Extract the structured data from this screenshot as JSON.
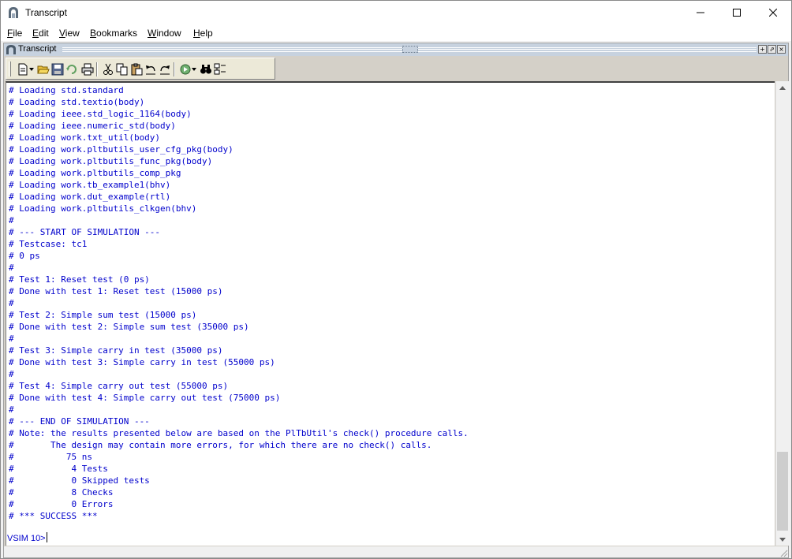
{
  "window": {
    "title": "Transcript",
    "controls": {
      "minimize": "—",
      "maximize": "☐",
      "close": "✕"
    }
  },
  "menu": {
    "file": {
      "accel": "F",
      "rest": "ile"
    },
    "edit": {
      "accel": "E",
      "rest": "dit"
    },
    "view": {
      "accel": "V",
      "rest": "iew"
    },
    "bookmarks": {
      "accel": "B",
      "rest": "ookmarks"
    },
    "window": {
      "accel": "W",
      "rest": "indow"
    },
    "help": {
      "accel": "H",
      "rest": "elp"
    }
  },
  "child": {
    "title": "Transcript"
  },
  "toolbar": {
    "buttons": [
      "new-icon",
      "open-icon",
      "save-icon",
      "reload-icon",
      "print-icon",
      "cut-icon",
      "copy-icon",
      "paste-icon",
      "undo-icon",
      "redo-icon",
      "go-icon",
      "find-icon",
      "options-icon"
    ]
  },
  "transcript": {
    "lines": [
      "# Loading std.standard",
      "# Loading std.textio(body)",
      "# Loading ieee.std_logic_1164(body)",
      "# Loading ieee.numeric_std(body)",
      "# Loading work.txt_util(body)",
      "# Loading work.pltbutils_user_cfg_pkg(body)",
      "# Loading work.pltbutils_func_pkg(body)",
      "# Loading work.pltbutils_comp_pkg",
      "# Loading work.tb_example1(bhv)",
      "# Loading work.dut_example(rtl)",
      "# Loading work.pltbutils_clkgen(bhv)",
      "#",
      "# --- START OF SIMULATION ---",
      "# Testcase: tc1",
      "# 0 ps",
      "#",
      "# Test 1: Reset test (0 ps)",
      "# Done with test 1: Reset test (15000 ps)",
      "#",
      "# Test 2: Simple sum test (15000 ps)",
      "# Done with test 2: Simple sum test (35000 ps)",
      "#",
      "# Test 3: Simple carry in test (35000 ps)",
      "# Done with test 3: Simple carry in test (55000 ps)",
      "#",
      "# Test 4: Simple carry out test (55000 ps)",
      "# Done with test 4: Simple carry out test (75000 ps)",
      "#",
      "# --- END OF SIMULATION ---",
      "# Note: the results presented below are based on the PlTbUtil's check() procedure calls.",
      "#       The design may contain more errors, for which there are no check() calls.",
      "#          75 ns",
      "#           4 Tests",
      "#           0 Skipped tests",
      "#           8 Checks",
      "#           0 Errors",
      "# *** SUCCESS ***"
    ],
    "prompt": "VSIM 10>"
  },
  "colors": {
    "transcript_text": "#0000cc",
    "child_title_bg": "#c7d2df"
  }
}
